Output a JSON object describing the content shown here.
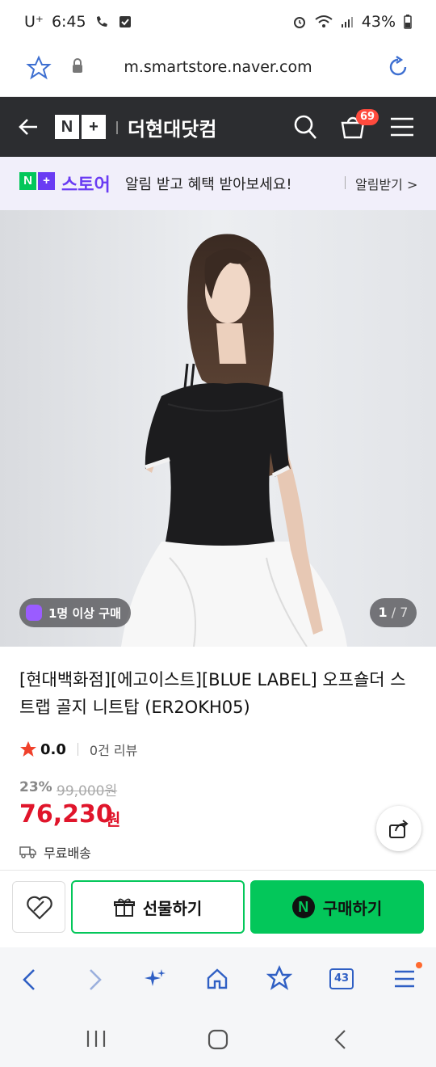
{
  "status_bar": {
    "carrier": "U⁺",
    "time": "6:45",
    "battery": "43%"
  },
  "url_bar": {
    "url": "m.smartstore.naver.com"
  },
  "nav": {
    "logo_text": "N+",
    "store_name": "더현대닷컴",
    "cart_count": "69"
  },
  "promo": {
    "logo_text": "N+",
    "brand": "스토어",
    "message": "알림 받고 혜택 받아보세요!",
    "action": "알림받기 >"
  },
  "product": {
    "badge": "1명 이상 구매",
    "page_current": "1",
    "page_total": "/ 7",
    "title": "[현대백화점][에고이스트][BLUE LABEL] 오프숄더 스트랩 골지 니트탑 (ER2OKH05)",
    "rating": "0.0",
    "reviews": "0건 리뷰",
    "discount": "23%",
    "original_price": "99,000원",
    "price": "76,230",
    "currency": "원",
    "shipping": "무료배송"
  },
  "actions": {
    "gift": "선물하기",
    "buy": "구매하기",
    "buy_logo": "N"
  },
  "browser": {
    "tabs_count": "43"
  },
  "colors": {
    "naver_green": "#03C75A",
    "price_red": "#E0152B",
    "nav_dark": "#2C2D30",
    "promo_purple": "#6A3CF3",
    "promo_bg": "#F1EFFA"
  }
}
